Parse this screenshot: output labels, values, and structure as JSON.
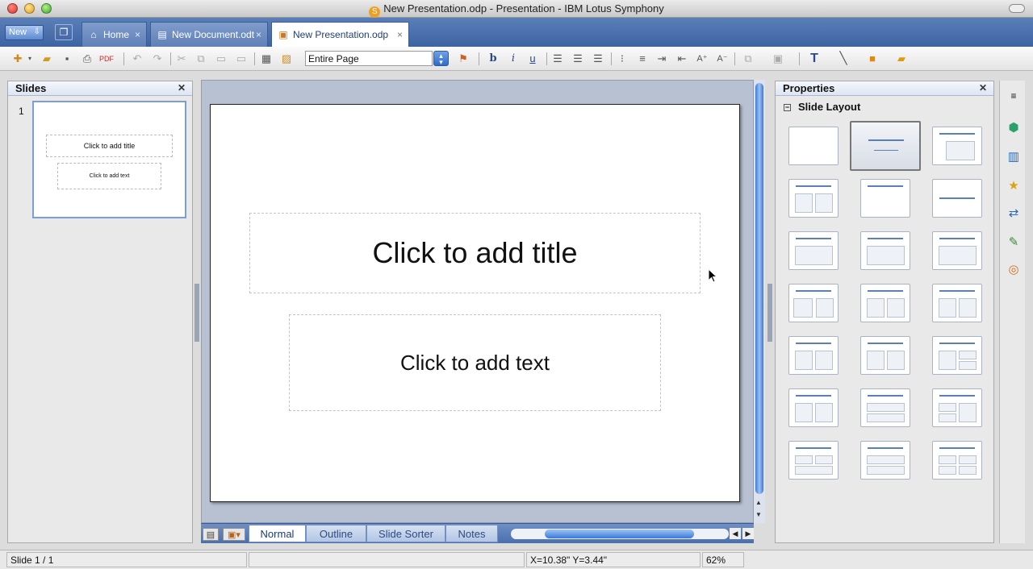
{
  "window": {
    "title": "New Presentation.odp - Presentation - IBM Lotus Symphony",
    "app_icon": "S"
  },
  "tabbar": {
    "new_label": "New",
    "tabs": [
      {
        "label": "Home",
        "icon": "home-icon"
      },
      {
        "label": "New Document.odt",
        "icon": "document-icon"
      },
      {
        "label": "New Presentation.odp",
        "icon": "presentation-icon",
        "active": true
      }
    ]
  },
  "toolbar": {
    "zoom_value": "Entire Page"
  },
  "slides_panel": {
    "title": "Slides",
    "slides": [
      {
        "number": "1",
        "title": "Click to add title",
        "text": "Click to add text"
      }
    ]
  },
  "slide": {
    "title_placeholder": "Click to add title",
    "text_placeholder": "Click to add text"
  },
  "view_tabs": [
    "Normal",
    "Outline",
    "Slide Sorter",
    "Notes"
  ],
  "properties_panel": {
    "title": "Properties",
    "section": "Slide Layout"
  },
  "statusbar": {
    "slide": "Slide 1 / 1",
    "position": "X=10.38\" Y=3.44\"",
    "zoom": "62%"
  },
  "colors": {
    "tab_bar": "#4a6fae",
    "accent": "#3a78d8",
    "layout_line": "#5b7fb8"
  }
}
